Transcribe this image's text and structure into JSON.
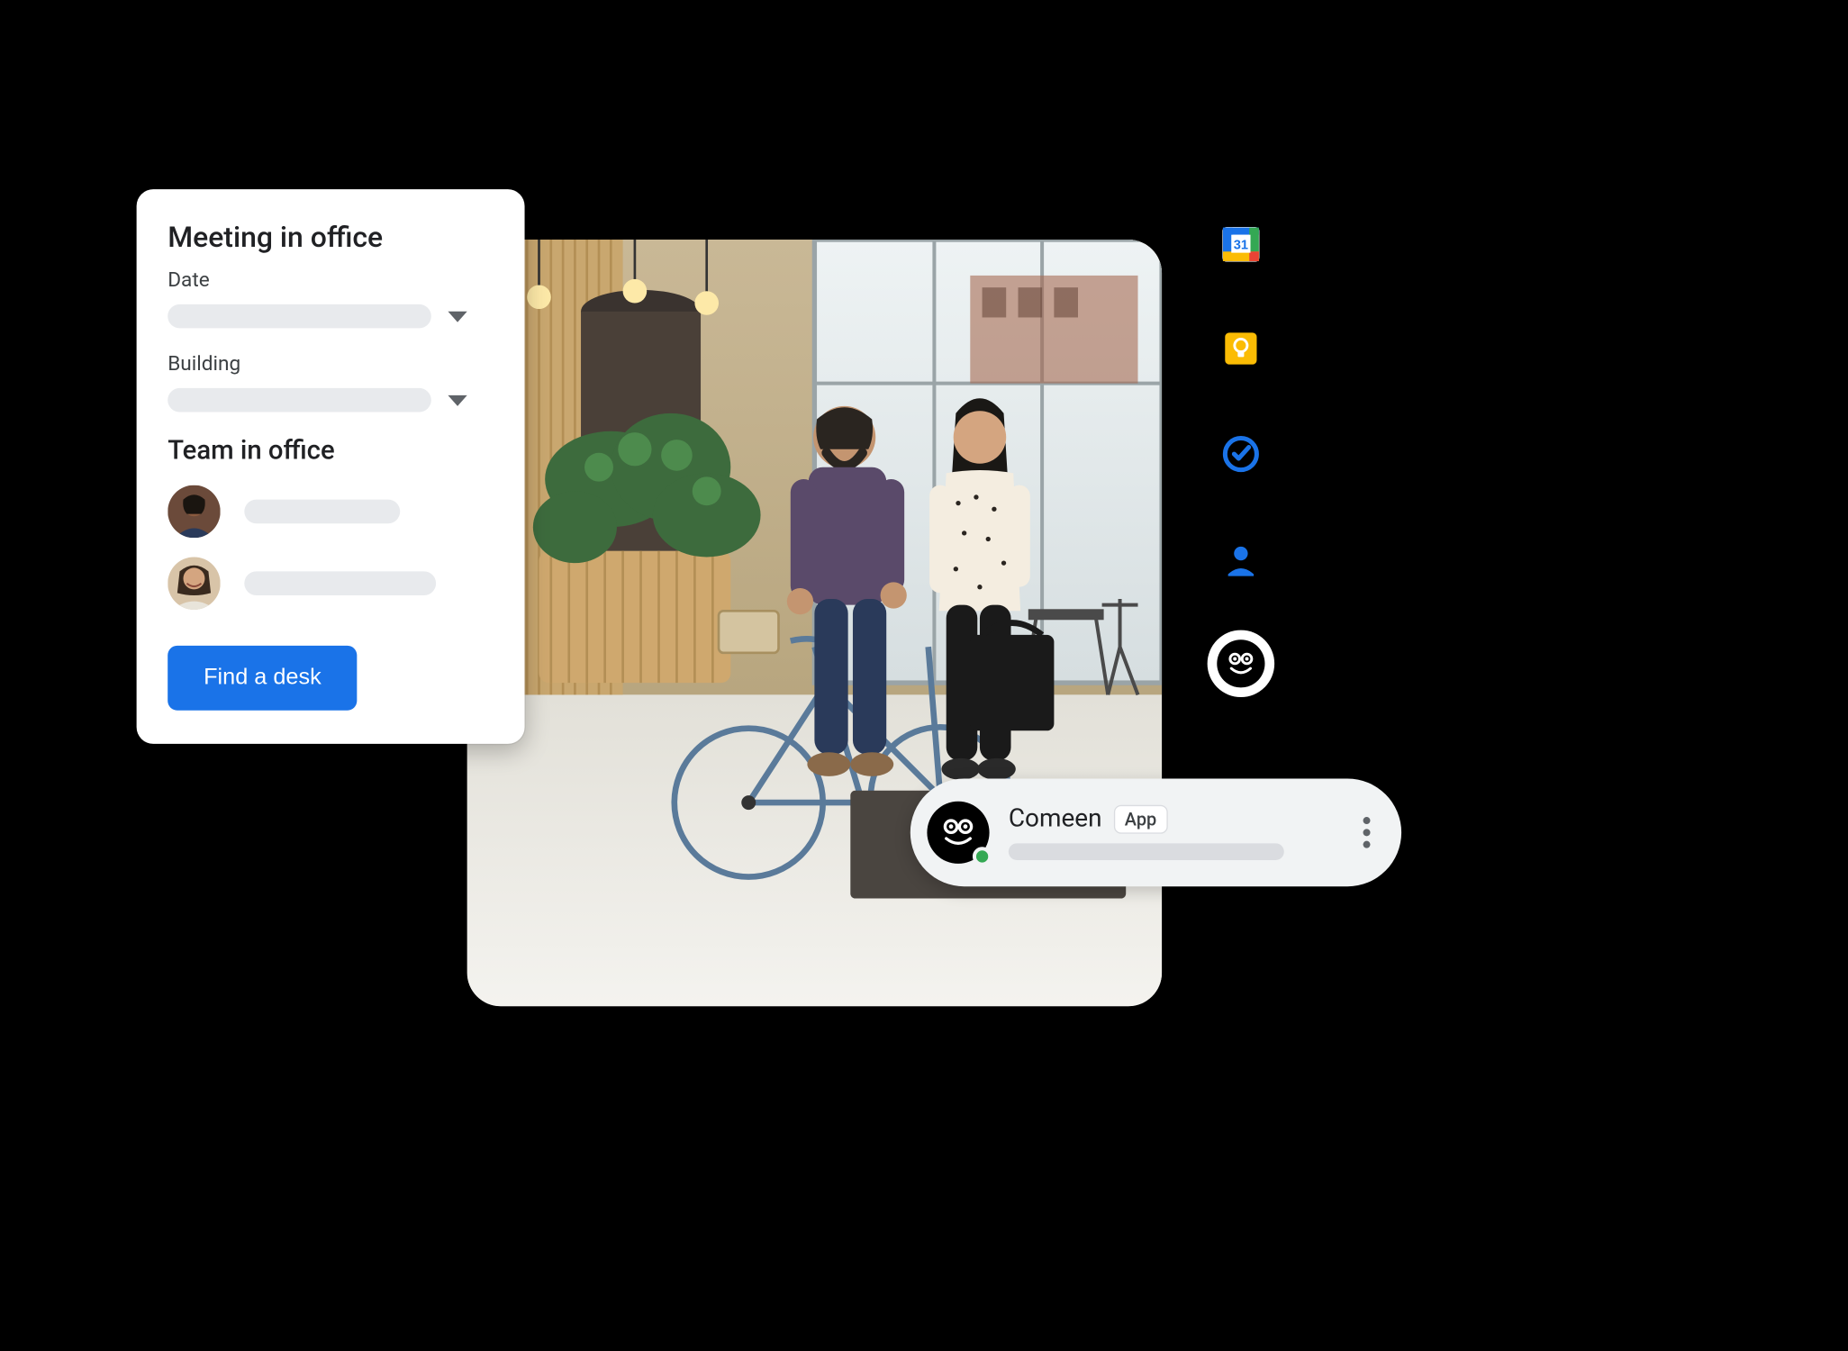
{
  "meeting_card": {
    "title": "Meeting in office",
    "date_label": "Date",
    "building_label": "Building",
    "team_heading": "Team in office",
    "find_button": "Find a desk"
  },
  "chat": {
    "name": "Comeen",
    "badge": "App"
  },
  "rail": {
    "calendar_day": "31"
  },
  "colors": {
    "primary_button": "#1a73e8",
    "google_blue": "#1a73e8",
    "google_yellow": "#fbbc04",
    "presence_green": "#34a853"
  }
}
